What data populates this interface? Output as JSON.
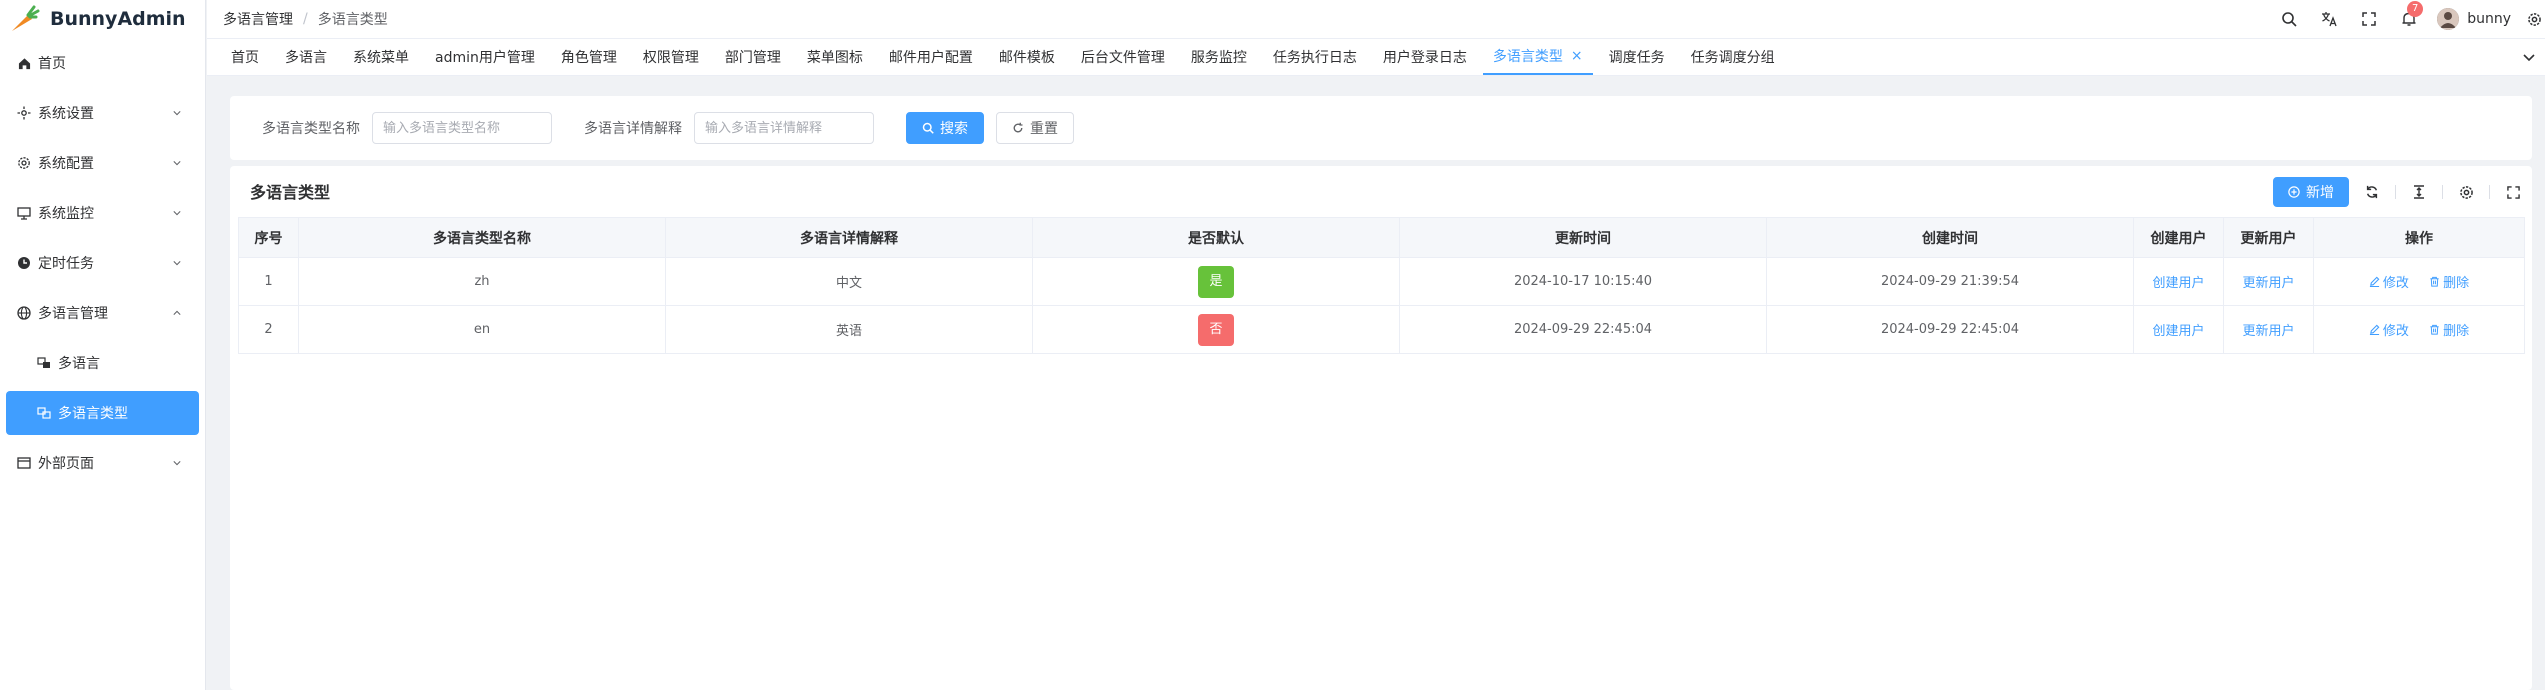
{
  "app": {
    "title": "BunnyAdmin"
  },
  "sidebar": {
    "items": [
      {
        "label": "首页",
        "icon": "home-icon"
      },
      {
        "label": "系统设置",
        "icon": "settings-icon",
        "expandable": true
      },
      {
        "label": "系统配置",
        "icon": "gear-icon",
        "expandable": true
      },
      {
        "label": "系统监控",
        "icon": "monitor-icon",
        "expandable": true
      },
      {
        "label": "定时任务",
        "icon": "clock-icon",
        "expandable": true
      },
      {
        "label": "多语言管理",
        "icon": "globe-icon",
        "expandable": true,
        "expanded": true
      },
      {
        "label": "多语言",
        "icon": "translate-icon",
        "sub": true
      },
      {
        "label": "多语言类型",
        "icon": "translate-icon",
        "sub": true,
        "active": true
      },
      {
        "label": "外部页面",
        "icon": "window-icon",
        "expandable": true
      }
    ]
  },
  "header": {
    "breadcrumb": [
      "多语言管理",
      "多语言类型"
    ],
    "notification_count": "7",
    "username": "bunny"
  },
  "tags": [
    "首页",
    "多语言",
    "系统菜单",
    "admin用户管理",
    "角色管理",
    "权限管理",
    "部门管理",
    "菜单图标",
    "邮件用户配置",
    "邮件模板",
    "后台文件管理",
    "服务监控",
    "任务执行日志",
    "用户登录日志",
    "多语言类型",
    "调度任务",
    "任务调度分组"
  ],
  "active_tag": "多语言类型",
  "search": {
    "type_name_label": "多语言类型名称",
    "type_name_placeholder": "输入多语言类型名称",
    "summary_label": "多语言详情解释",
    "summary_placeholder": "输入多语言详情解释",
    "search_button": "搜索",
    "reset_button": "重置"
  },
  "table": {
    "title": "多语言类型",
    "add_button": "新增",
    "columns": [
      "序号",
      "多语言类型名称",
      "多语言详情解释",
      "是否默认",
      "更新时间",
      "创建时间",
      "创建用户",
      "更新用户",
      "操作"
    ],
    "rows": [
      {
        "index": "1",
        "name": "zh",
        "summary": "中文",
        "is_default": "是",
        "default_color": "#67c23a",
        "update_time": "2024-10-17 10:15:40",
        "create_time": "2024-09-29 21:39:54",
        "create_user": "创建用户",
        "update_user": "更新用户",
        "edit": "修改",
        "delete": "删除"
      },
      {
        "index": "2",
        "name": "en",
        "summary": "英语",
        "is_default": "否",
        "default_color": "#f56c6c",
        "update_time": "2024-09-29 22:45:04",
        "create_time": "2024-09-29 22:45:04",
        "create_user": "创建用户",
        "update_user": "更新用户",
        "edit": "修改",
        "delete": "删除"
      }
    ]
  },
  "colors": {
    "primary": "#409eff",
    "success": "#67c23a",
    "danger": "#f56c6c"
  }
}
